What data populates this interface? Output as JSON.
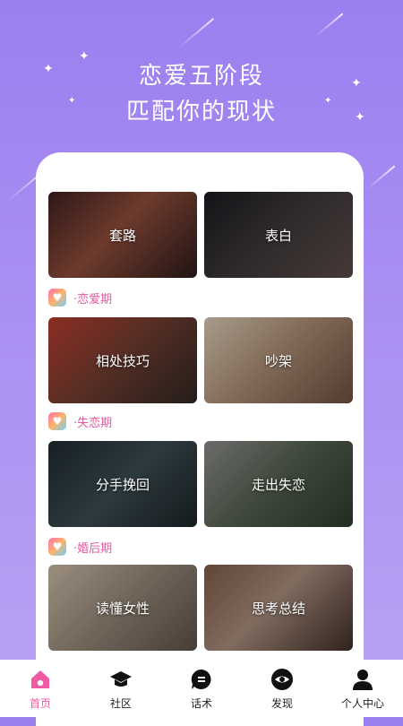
{
  "hero": {
    "title": "恋爱五阶段",
    "subtitle": "匹配你的现状"
  },
  "cards": [
    {
      "label": "套路"
    },
    {
      "label": "表白"
    },
    {
      "label": "相处技巧"
    },
    {
      "label": "吵架"
    },
    {
      "label": "分手挽回"
    },
    {
      "label": "走出失恋"
    },
    {
      "label": "读懂女性"
    },
    {
      "label": "思考总结"
    }
  ],
  "sections": [
    {
      "title": "·恋爱期"
    },
    {
      "title": "·失恋期"
    },
    {
      "title": "·婚后期"
    }
  ],
  "tabs": [
    {
      "label": "首页",
      "icon": "home-icon",
      "active": true
    },
    {
      "label": "社区",
      "icon": "graduation-cap-icon",
      "active": false
    },
    {
      "label": "话术",
      "icon": "chat-bubble-icon",
      "active": false
    },
    {
      "label": "发现",
      "icon": "eye-icon",
      "active": false
    },
    {
      "label": "个人中心",
      "icon": "person-icon",
      "active": false
    }
  ],
  "colors": {
    "accent": "#ef5aa2",
    "background": "#9a7ff0"
  }
}
